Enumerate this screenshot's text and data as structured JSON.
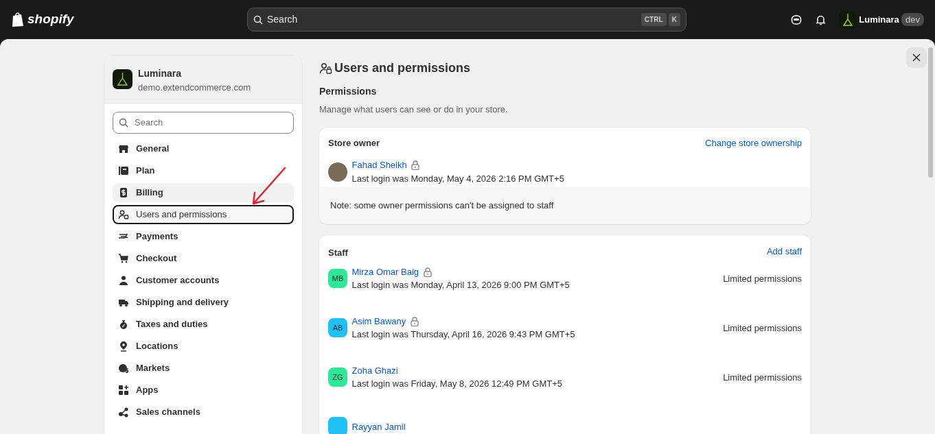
{
  "topbar": {
    "brand": "shopify",
    "search": {
      "placeholder": "Search",
      "keys": [
        "CTRL",
        "K"
      ]
    },
    "store": "Luminara",
    "store_badge": "dev"
  },
  "sidebar": {
    "store_name": "Luminara",
    "store_domain": "demo.extendcommerce.com",
    "search": {
      "placeholder": "Search"
    },
    "items": [
      {
        "label": "General",
        "selected": false,
        "highlighted": false
      },
      {
        "label": "Plan",
        "selected": false,
        "highlighted": false
      },
      {
        "label": "Billing",
        "selected": false,
        "highlighted": true
      },
      {
        "label": "Users and permissions",
        "selected": true,
        "highlighted": false
      },
      {
        "label": "Payments",
        "selected": false,
        "highlighted": false
      },
      {
        "label": "Checkout",
        "selected": false,
        "highlighted": false
      },
      {
        "label": "Customer accounts",
        "selected": false,
        "highlighted": false
      },
      {
        "label": "Shipping and delivery",
        "selected": false,
        "highlighted": false
      },
      {
        "label": "Taxes and duties",
        "selected": false,
        "highlighted": false
      },
      {
        "label": "Locations",
        "selected": false,
        "highlighted": false
      },
      {
        "label": "Markets",
        "selected": false,
        "highlighted": false
      },
      {
        "label": "Apps",
        "selected": false,
        "highlighted": false
      },
      {
        "label": "Sales channels",
        "selected": false,
        "highlighted": false
      }
    ]
  },
  "page": {
    "title": "Users and permissions",
    "section_title": "Permissions",
    "section_description": "Manage what users can see or do in your store.",
    "owner_card": {
      "heading": "Store owner",
      "action": "Change store ownership",
      "owner": {
        "name": "Fahad Sheikh",
        "locked": true,
        "last_login": "Last login was Monday, May 4, 2026 2:16 PM GMT+5"
      },
      "note": "Note: some owner permissions can't be assigned to staff"
    },
    "staff_card": {
      "heading": "Staff",
      "action": "Add staff",
      "members": [
        {
          "initials": "MB",
          "color": "#2ee89a",
          "name": "Mirza Omar Baig",
          "locked": true,
          "last_login": "Last login was Monday, April 13, 2026 9:00 PM GMT+5",
          "permissions": "Limited permissions"
        },
        {
          "initials": "AB",
          "color": "#1ec0f5",
          "name": "Asim Bawany",
          "locked": true,
          "last_login": "Last login was Thursday, April 16, 2026 9:43 PM GMT+5",
          "permissions": "Limited permissions"
        },
        {
          "initials": "ZG",
          "color": "#2ee89a",
          "name": "Zoha Ghazi",
          "locked": false,
          "last_login": "Last login was Friday, May 8, 2026 12:49 PM GMT+5",
          "permissions": "Limited permissions"
        },
        {
          "color": "#1ec0f5",
          "name": "Rayyan Jamil",
          "locked": false
        }
      ]
    }
  }
}
